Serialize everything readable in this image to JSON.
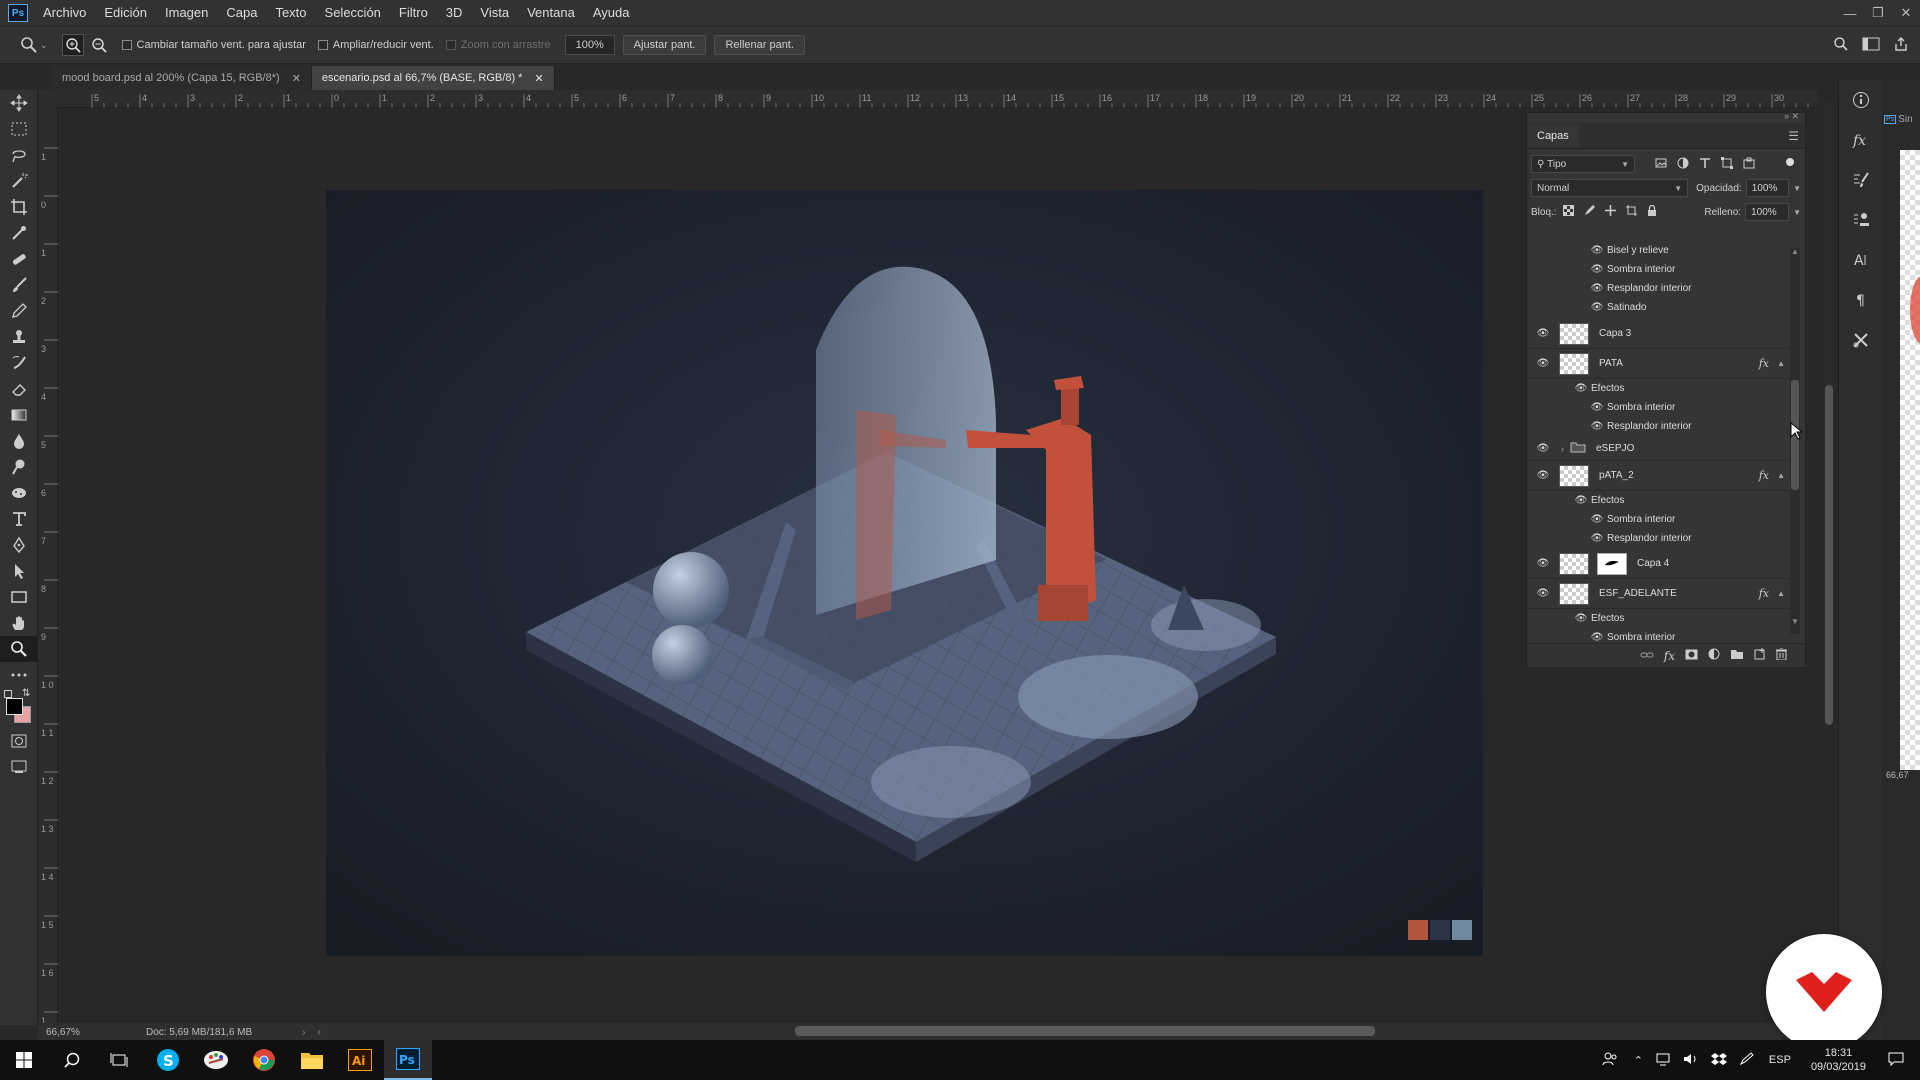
{
  "menubar": {
    "items": [
      "Archivo",
      "Edición",
      "Imagen",
      "Capa",
      "Texto",
      "Selección",
      "Filtro",
      "3D",
      "Vista",
      "Ventana",
      "Ayuda"
    ]
  },
  "options": {
    "resize_windows": "Cambiar tamaño vent. para ajustar",
    "zoom_all_windows": "Ampliar/reducir vent.",
    "scrubby_zoom": "Zoom con arrastre",
    "zoom_value": "100%",
    "fit_screen": "Ajustar pant.",
    "fill_screen": "Rellenar pant."
  },
  "tabs": [
    {
      "label": "mood board.psd al 200% (Capa 15, RGB/8*)",
      "active": false
    },
    {
      "label": "escenario.psd al 66,7% (BASE, RGB/8) *",
      "active": true
    }
  ],
  "ruler_top": [
    "5",
    "4",
    "3",
    "2",
    "1",
    "0",
    "1",
    "2",
    "3",
    "4",
    "5",
    "6",
    "7",
    "8",
    "9",
    "10",
    "11",
    "12",
    "13",
    "14",
    "15",
    "16",
    "17",
    "18",
    "19",
    "20",
    "21",
    "22",
    "23",
    "24",
    "25",
    "26",
    "27",
    "28",
    "29",
    "30",
    "3"
  ],
  "ruler_left": [
    "1",
    "0",
    "1",
    "2",
    "3",
    "4",
    "5",
    "6",
    "7",
    "8",
    "9",
    "1 0",
    "1 1",
    "1 2",
    "1 3",
    "1 4",
    "1 5",
    "1 6",
    "1"
  ],
  "layers_panel": {
    "title": "Capas",
    "filter_kind": "Tipo",
    "blend_mode": "Normal",
    "opacity_label": "Opacidad:",
    "opacity_value": "100%",
    "lock_label": "Bloq.:",
    "fill_label": "Relleno:",
    "fill_value": "100%",
    "effects_label": "Efectos",
    "layers": {
      "bisel": "Bisel y relieve",
      "sombra1": "Sombra interior",
      "resplandor1": "Resplandor interior",
      "satinado": "Satinado",
      "capa3": "Capa 3",
      "pata": "PATA",
      "sombra2": "Sombra interior",
      "resplandor2": "Resplandor interior",
      "espejo": "eSEPJO",
      "pata2": "pATA_2",
      "sombra3": "Sombra interior",
      "resplandor3": "Resplandor interior",
      "capa4": "Capa 4",
      "esf": "ESF_ADELANTE",
      "sombra4": "Sombra interior"
    }
  },
  "status": {
    "zoom": "66,67%",
    "doc": "Doc: 5,69 MB/181,6 MB"
  },
  "far_right": {
    "tab_label": "Sin",
    "zoom": "66,67"
  },
  "taskbar": {
    "lang": "ESP",
    "time": "18:31",
    "date": "09/03/2019"
  },
  "colors": {
    "accent_blue": "#76b9ed",
    "palette_1": "#b4553f",
    "palette_2": "#2c3448",
    "palette_3": "#6f8aa0",
    "figure": "#c3503a",
    "floor": "#5f6d8a",
    "watermark_red": "#e0211b"
  }
}
